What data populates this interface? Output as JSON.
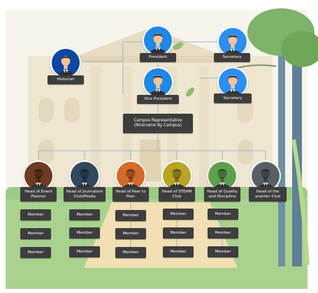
{
  "colors": {
    "sky": "#f7f4ec",
    "building": "#efe6d2",
    "grass": "#93c47d",
    "path": "#f2dfb4",
    "label_bg": "#3d3d3d",
    "connector": "#9fb6c6"
  },
  "officers": {
    "president": {
      "label": "President",
      "avatar_bg": "#1e88e5",
      "icon": "person-avatar-icon"
    },
    "secretary_top": {
      "label": "Secretary",
      "avatar_bg": "#2b8ef0",
      "icon": "person-avatar-icon"
    },
    "historian": {
      "label": "Historian",
      "avatar_bg": "#0d47a1",
      "icon": "person-avatar-icon"
    },
    "vice_president": {
      "label": "Vice President",
      "avatar_bg": "#1e88e5",
      "icon": "person-avatar-icon"
    },
    "secretary_bottom": {
      "label": "Secretary",
      "avatar_bg": "#2b8ef0",
      "icon": "person-avatar-icon"
    }
  },
  "campus_rep": {
    "label": "Campus Representative (Nickname By Campus)"
  },
  "heads": [
    {
      "label": "Head of Event Planner",
      "avatar_bg": "#6d3b22",
      "icon": "person-avatar-icon"
    },
    {
      "label": "Head of Journalism Club/Media",
      "avatar_bg": "#33485e",
      "icon": "person-avatar-icon"
    },
    {
      "label": "Head of Peer to Peer",
      "avatar_bg": "#d46a2c",
      "icon": "person-avatar-icon"
    },
    {
      "label": "Head of STEAM Club",
      "avatar_bg": "#b8a524",
      "icon": "person-avatar-icon"
    },
    {
      "label": "Head of Quality and Discipline",
      "avatar_bg": "#5fa04e",
      "icon": "person-avatar-icon"
    },
    {
      "label": "Head of the another Club",
      "avatar_bg": "#5a5e66",
      "icon": "person-avatar-icon"
    }
  ],
  "member_label": "Member",
  "members_per_head": 3
}
